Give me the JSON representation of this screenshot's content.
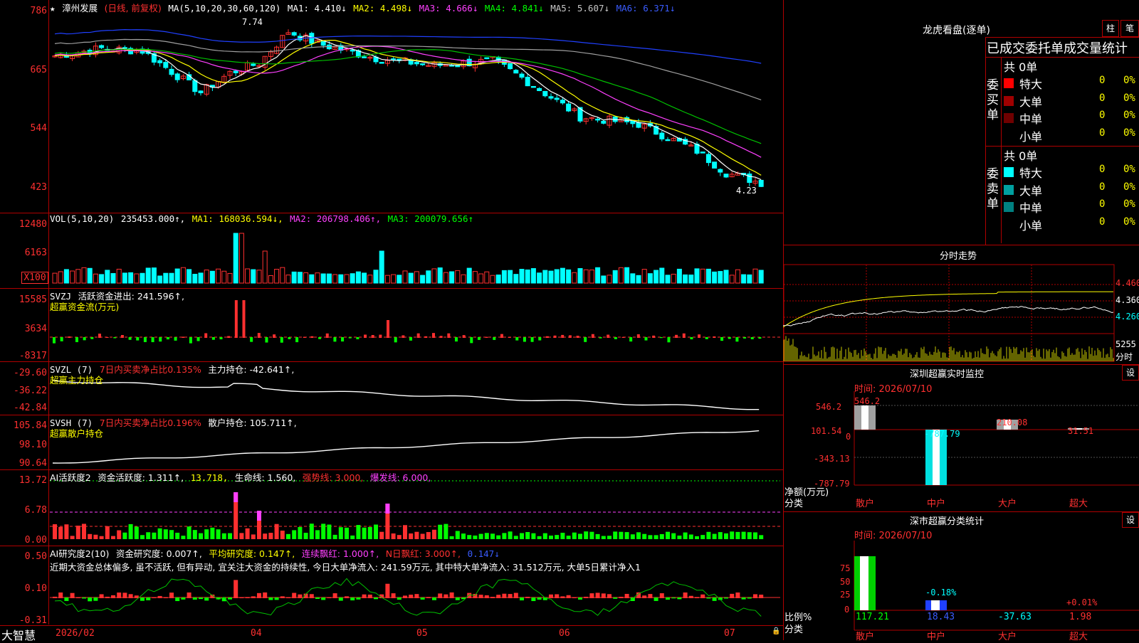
{
  "kline": {
    "star": "★",
    "stock_name": "漳州发展",
    "mode": "(日线, 前复权)",
    "ma_params": "MA(5,10,20,30,60,120)",
    "ma1": "MA1: 4.410↓",
    "ma2": "MA2: 4.498↓",
    "ma3": "MA3: 4.666↓",
    "ma4": "MA4: 4.841↓",
    "ma5": "MA5: 5.607↓",
    "ma6": "MA6: 6.371↓",
    "axis": [
      "786",
      "665",
      "544",
      "423"
    ],
    "high_label": "7.74",
    "low_label": "4.23"
  },
  "vol": {
    "title": "VOL(5,10,20)",
    "value": "235453.000↑,",
    "ma1": "MA1: 168036.594↓,",
    "ma2": "MA2: 206798.406↑,",
    "ma3": "MA3: 200079.656↑",
    "axis": [
      "12480",
      "6163",
      "X100"
    ]
  },
  "svzj": {
    "title": "SVZJ",
    "label": "活跃资金进出: 241.596↑,",
    "subtitle": "超赢资金流(万元)",
    "axis": [
      "15585",
      "3634",
      "-8317"
    ]
  },
  "svzl": {
    "title": "SVZL (7)",
    "label": "7日内买卖净占比0.135%",
    "label2": "主力持仓: -42.641↑,",
    "subtitle": "超赢主力持仓",
    "axis": [
      "-29.60",
      "-36.22",
      "-42.84"
    ]
  },
  "svsh": {
    "title": "SVSH (7)",
    "label": "7日内买卖净占比0.196%",
    "label2": "散户持仓: 105.711↑,",
    "subtitle": "超赢散户持仓",
    "axis": [
      "105.84",
      "98.10",
      "90.64"
    ]
  },
  "ai": {
    "title": "AI活跃度2",
    "l1": "资金活跃度: 1.311↑,",
    "l2": "13.718,",
    "l3": "生命线: 1.560,",
    "l4": "强势线: 3.000,",
    "l5": "爆发线: 6.000,",
    "axis": [
      "13.72",
      "6.78",
      "0.00"
    ]
  },
  "research": {
    "title": "AI研究度2(10)",
    "l1": "资金研究度: 0.007↑,",
    "l2": "平均研究度: 0.147↑,",
    "l3": "连续飘红: 1.000↑,",
    "l4": "N日飘红: 3.000↑,",
    "l5": "0.147↓",
    "comment": "近期大资金总体偏多, 虽不活跃, 但有异动, 宜关注大资金的持续性, 今日大单净流入: 241.59万元, 其中特大单净流入: 31.512万元, 大单5日累计净入1",
    "axis": [
      "0.50",
      "0.10",
      "-0.31"
    ]
  },
  "bottom": {
    "app_name": "大智慧",
    "dates": [
      "2026/02",
      "04",
      "05",
      "06",
      "07"
    ]
  },
  "right": {
    "dragon_title": "龙虎看盘(逐单)",
    "btn_bar": "柱",
    "btn_pen": "笔",
    "stat_title": "已成交委托单成交量统计",
    "buy_label": "委买单",
    "sell_label": "委卖单",
    "buy_total": "共 0单",
    "sell_total": "共 0单",
    "buy_rows": [
      {
        "name": "特大",
        "count": "0",
        "pct": "0%",
        "color": "#ff0000"
      },
      {
        "name": "大单",
        "count": "0",
        "pct": "0%",
        "color": "#a00000"
      },
      {
        "name": "中单",
        "count": "0",
        "pct": "0%",
        "color": "#700000"
      },
      {
        "name": "小单",
        "count": "0",
        "pct": "0%",
        "color": "#000000"
      }
    ],
    "sell_rows": [
      {
        "name": "特大",
        "count": "0",
        "pct": "0%",
        "color": "#00ffff"
      },
      {
        "name": "大单",
        "count": "0",
        "pct": "0%",
        "color": "#00a0a0"
      },
      {
        "name": "中单",
        "count": "0",
        "pct": "0%",
        "color": "#008080"
      },
      {
        "name": "小单",
        "count": "0",
        "pct": "0%",
        "color": "#000000"
      }
    ],
    "intraday_title": "分时走势",
    "intraday_axis": [
      "4.460",
      "4.360",
      "4.260"
    ],
    "intraday_vol": "5255",
    "intraday_vol_label": "分时",
    "monitor_title": "深圳超赢实时监控",
    "monitor_btn": "设",
    "monitor_time": "时间: 2026/07/10",
    "monitor_axis": [
      "546.2",
      "101.54",
      "0",
      "-343.13",
      "-787.79"
    ],
    "monitor_ylabel": "净额(万元)",
    "monitor_xlabel": "分类",
    "monitor_cats": [
      "散户",
      "中户",
      "大户",
      "超大"
    ],
    "monitor_values": [
      "546.2",
      "-787.79",
      "210.08",
      "31.51"
    ],
    "class_title": "深市超赢分类统计",
    "class_btn": "设",
    "class_time": "时间: 2026/07/10",
    "class_axis": [
      "75",
      "50",
      "25",
      "0"
    ],
    "class_ylabel": "比例%",
    "class_xlabel": "分类",
    "class_cats": [
      "散户",
      "中户",
      "大户",
      "超大"
    ],
    "class_pcts": [
      "",
      "-0.18%",
      "",
      "+0.01%"
    ],
    "class_vals": [
      "117.21",
      "18.43",
      "-37.63",
      "1.98"
    ]
  },
  "colors": {
    "up": "#ff3030",
    "down": "#00ffff",
    "grid": "#b00000",
    "ma_white": "#ffffff",
    "ma_yellow": "#ffff00",
    "ma_magenta": "#ff40ff",
    "ma_green": "#00c000",
    "ma_gray": "#a0a0a0",
    "ma_blue": "#2040ff"
  }
}
